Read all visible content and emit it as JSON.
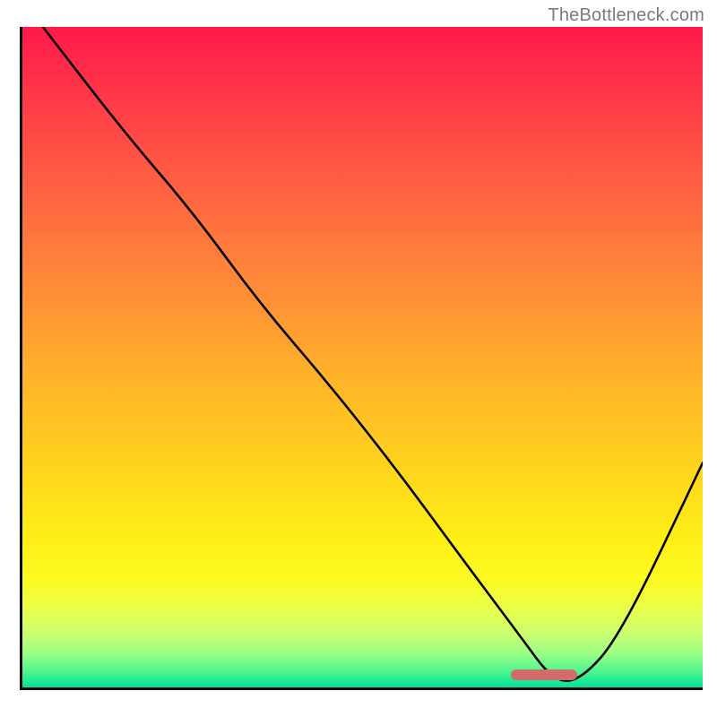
{
  "watermark": "TheBottleneck.com",
  "chart_data": {
    "type": "line",
    "title": "",
    "xlabel": "",
    "ylabel": "",
    "xlim": [
      0,
      100
    ],
    "ylim": [
      0,
      100
    ],
    "series": [
      {
        "name": "curve",
        "x": [
          3,
          15,
          25,
          35,
          45,
          55,
          65,
          73,
          78,
          82,
          88,
          100
        ],
        "values": [
          100,
          84,
          72,
          58,
          46,
          33,
          19,
          8,
          1,
          1,
          8,
          34
        ]
      }
    ],
    "annotations": [
      {
        "name": "optimal-marker",
        "x_range": [
          72,
          82
        ],
        "color": "#d36b6a"
      }
    ],
    "background": "vertical-gradient red→orange→yellow→green"
  }
}
